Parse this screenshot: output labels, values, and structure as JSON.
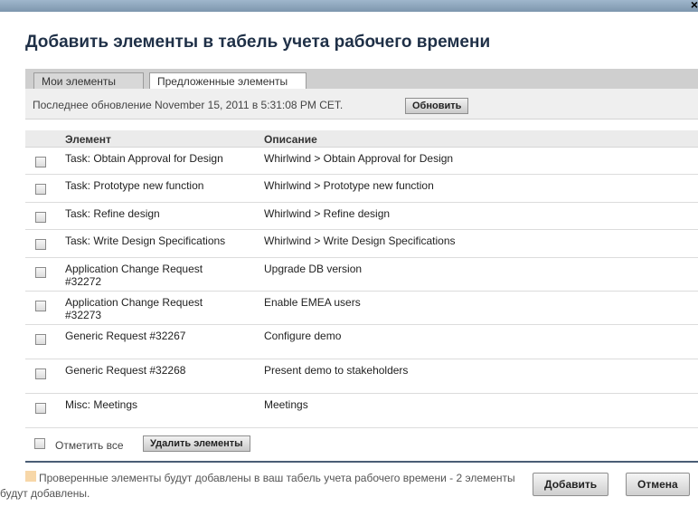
{
  "window": {
    "close_glyph": "×"
  },
  "dialog": {
    "title": "Добавить элементы в табель учета рабочего времени"
  },
  "tabs": [
    {
      "label": "Мои элементы",
      "active": false
    },
    {
      "label": "Предложенные элементы",
      "active": true
    }
  ],
  "update": {
    "text": "Последнее обновление November 15, 2011 в 5:31:08 PM CET.",
    "refresh_label": "Обновить"
  },
  "table": {
    "columns": {
      "item": "Элемент",
      "description": "Описание"
    },
    "rows": [
      {
        "item": "Task: Obtain Approval for Design",
        "description": "Whirlwind > Obtain Approval for Design",
        "checked": false
      },
      {
        "item": "Task: Prototype new function",
        "description": "Whirlwind > Prototype new function",
        "checked": false
      },
      {
        "item": "Task: Refine design",
        "description": "Whirlwind > Refine design",
        "checked": false
      },
      {
        "item": "Task: Write Design Specifications",
        "description": "Whirlwind > Write Design Specifications",
        "checked": false
      },
      {
        "item": "Application Change Request #32272",
        "description": "Upgrade DB version",
        "checked": false
      },
      {
        "item": "Application Change Request #32273",
        "description": "Enable EMEA users",
        "checked": false
      },
      {
        "item": "Generic Request #32267",
        "description": "Configure demo",
        "checked": false
      },
      {
        "item": "Generic Request #32268",
        "description": "Present demo to stakeholders",
        "checked": false
      },
      {
        "item": "Misc: Meetings",
        "description": "Meetings",
        "checked": false
      }
    ]
  },
  "actions": {
    "check_all_label": "Отметить все",
    "remove_label": "Удалить элементы"
  },
  "footer": {
    "note": "Проверенные элементы будут добавлены в ваш табель учета рабочего времени - 2 элементы будут добавлены.",
    "add_label": "Добавить",
    "cancel_label": "Отмена"
  },
  "colors": {
    "titlebar": "#8ba3ba",
    "title_text": "#1f3047",
    "legend_swatch": "#f7d7a8",
    "divider": "#4a5d75"
  }
}
